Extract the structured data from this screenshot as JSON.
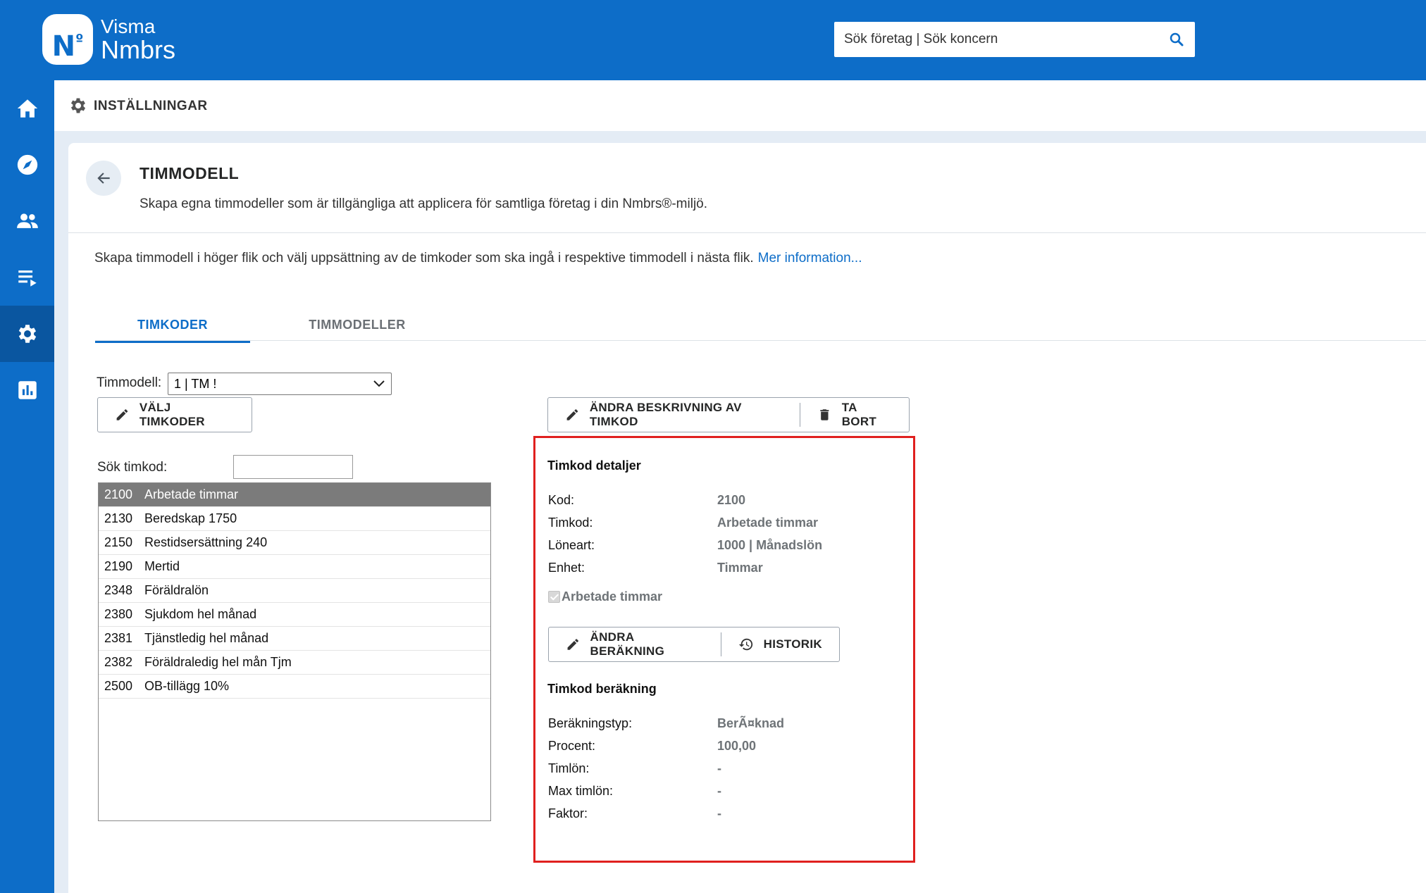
{
  "brand": {
    "line1": "Visma",
    "line2": "Nmbrs",
    "badge": "N",
    "badge_sup": "º"
  },
  "search": {
    "placeholder": "Sök företag | Sök koncern"
  },
  "sidebar": {
    "items": [
      {
        "icon": "home-icon"
      },
      {
        "icon": "compass-icon"
      },
      {
        "icon": "people-icon"
      },
      {
        "icon": "list-icon"
      },
      {
        "icon": "gear-icon",
        "active": true
      },
      {
        "icon": "chart-icon"
      }
    ]
  },
  "breadcrumb": {
    "label": "INSTÄLLNINGAR"
  },
  "page": {
    "title": "TIMMODELL",
    "subtitle": "Skapa egna timmodeller som är tillgängliga att applicera för samtliga företag i din Nmbrs®-miljö.",
    "info": "Skapa timmodell i höger flik och välj uppsättning av de timkoder som ska ingå i respektive timmodell i nästa flik.",
    "info_link": "Mer information..."
  },
  "tabs": [
    {
      "label": "TIMKODER",
      "active": true
    },
    {
      "label": "TIMMODELLER"
    }
  ],
  "model": {
    "label": "Timmodell:",
    "selected": "1 | TM !"
  },
  "buttons": {
    "choose_codes": "VÄLJ TIMKODER",
    "edit_description": "ÄNDRA BESKRIVNING AV TIMKOD",
    "delete": "TA BORT",
    "edit_calc": "ÄNDRA BERÄKNING",
    "history": "HISTORIK"
  },
  "code_search": {
    "label": "Sök timkod:",
    "value": ""
  },
  "codes": [
    {
      "code": "2100",
      "name": "Arbetade timmar",
      "selected": true
    },
    {
      "code": "2130",
      "name": "Beredskap 1750"
    },
    {
      "code": "2150",
      "name": "Restidsersättning 240"
    },
    {
      "code": "2190",
      "name": "Mertid"
    },
    {
      "code": "2348",
      "name": "Föräldralön"
    },
    {
      "code": "2380",
      "name": "Sjukdom hel månad"
    },
    {
      "code": "2381",
      "name": "Tjänstledig hel månad"
    },
    {
      "code": "2382",
      "name": "Föräldraledig hel mån Tjm"
    },
    {
      "code": "2500",
      "name": "OB-tillägg 10%"
    }
  ],
  "details": {
    "heading": "Timkod detaljer",
    "fields": [
      {
        "label": "Kod:",
        "value": "2100"
      },
      {
        "label": "Timkod:",
        "value": "Arbetade timmar"
      },
      {
        "label": "Löneart:",
        "value": "1000 | Månadslön"
      },
      {
        "label": "Enhet:",
        "value": "Timmar"
      }
    ],
    "checkbox_label": "Arbetade timmar",
    "calc_heading": "Timkod beräkning",
    "calc_fields": [
      {
        "label": "Beräkningstyp:",
        "value": "BerÃ¤knad"
      },
      {
        "label": "Procent:",
        "value": "100,00"
      },
      {
        "label": "Timlön:",
        "value": "-"
      },
      {
        "label": "Max timlön:",
        "value": "-"
      },
      {
        "label": "Faktor:",
        "value": "-"
      }
    ]
  },
  "colors": {
    "primary": "#0d6dc8",
    "highlight": "#e0201f",
    "selected_row": "#7b7b7b"
  }
}
